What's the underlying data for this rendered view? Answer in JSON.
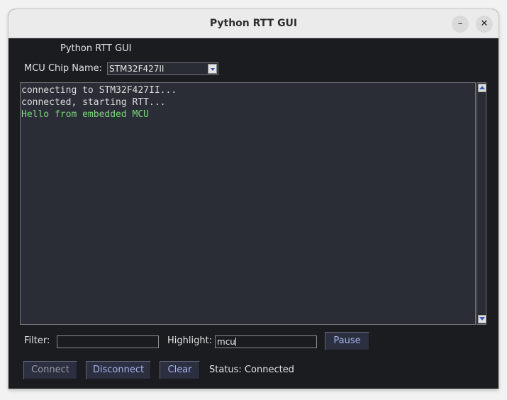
{
  "window": {
    "title": "Python RTT GUI"
  },
  "header": {
    "app_label": "Python RTT GUI"
  },
  "chip": {
    "label": "MCU Chip Name:",
    "value": "STM32F427II"
  },
  "log": {
    "lines": [
      {
        "text": "connecting to STM32F427II...",
        "color": "#dcdcdc"
      },
      {
        "text": "connected, starting RTT...",
        "color": "#dcdcdc"
      },
      {
        "text": "Hello from embedded MCU",
        "color": "#7dd87d"
      }
    ]
  },
  "filter": {
    "label": "Filter:",
    "value": ""
  },
  "highlight": {
    "label": "Highlight:",
    "value": "mcu"
  },
  "buttons": {
    "pause": "Pause",
    "connect": "Connect",
    "disconnect": "Disconnect",
    "clear": "Clear"
  },
  "status": {
    "text": "Status: Connected"
  },
  "colors": {
    "background": "#1b1c1f",
    "log_background": "#2a2d35",
    "button_bg": "#2b2f40",
    "button_text_active": "#a5b4f0",
    "button_text_disabled": "#9a9aa4",
    "highlight_text": "#7dd87d"
  },
  "icons": {
    "minimize": "minimize-icon",
    "close": "close-icon",
    "dropdown": "chevron-down-icon"
  }
}
